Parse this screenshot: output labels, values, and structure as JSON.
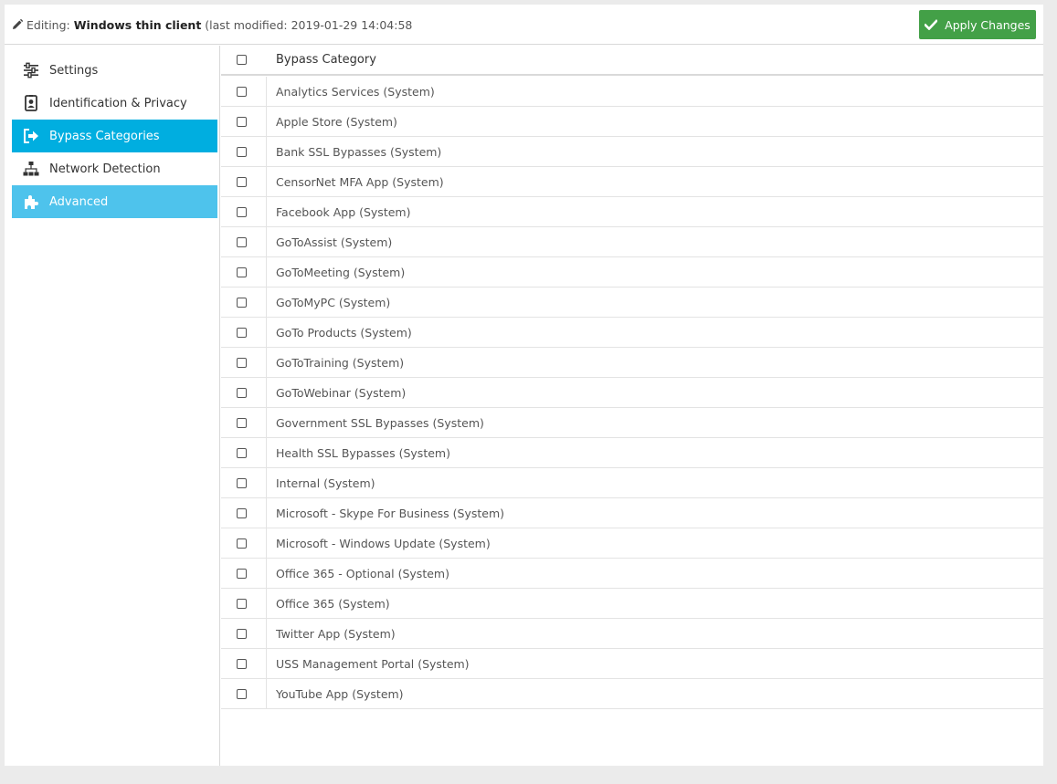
{
  "header": {
    "editing_label": "Editing:",
    "name": "Windows thin client",
    "modified_text": "(last modified: 2019-01-29 14:04:58",
    "apply_label": "Apply Changes"
  },
  "colors": {
    "accent": "#00aee0",
    "advanced": "#4ec3ec",
    "apply": "#43a047"
  },
  "sidebar": {
    "items": [
      {
        "label": "Settings",
        "icon": "sliders-icon",
        "state": "normal"
      },
      {
        "label": "Identification & Privacy",
        "icon": "id-badge-icon",
        "state": "normal"
      },
      {
        "label": "Bypass Categories",
        "icon": "sign-out-icon",
        "state": "active"
      },
      {
        "label": "Network Detection",
        "icon": "sitemap-icon",
        "state": "normal"
      },
      {
        "label": "Advanced",
        "icon": "puzzle-icon",
        "state": "highlight"
      }
    ]
  },
  "table": {
    "header": "Bypass Category",
    "rows": [
      "Analytics Services (System)",
      "Apple Store (System)",
      "Bank SSL Bypasses (System)",
      "CensorNet MFA App (System)",
      "Facebook App (System)",
      "GoToAssist (System)",
      "GoToMeeting (System)",
      "GoToMyPC (System)",
      "GoTo Products (System)",
      "GoToTraining (System)",
      "GoToWebinar (System)",
      "Government SSL Bypasses (System)",
      "Health SSL Bypasses (System)",
      "Internal (System)",
      "Microsoft - Skype For Business (System)",
      "Microsoft - Windows Update (System)",
      "Office 365 - Optional (System)",
      "Office 365 (System)",
      "Twitter App (System)",
      "USS Management Portal (System)",
      "YouTube App (System)"
    ]
  }
}
